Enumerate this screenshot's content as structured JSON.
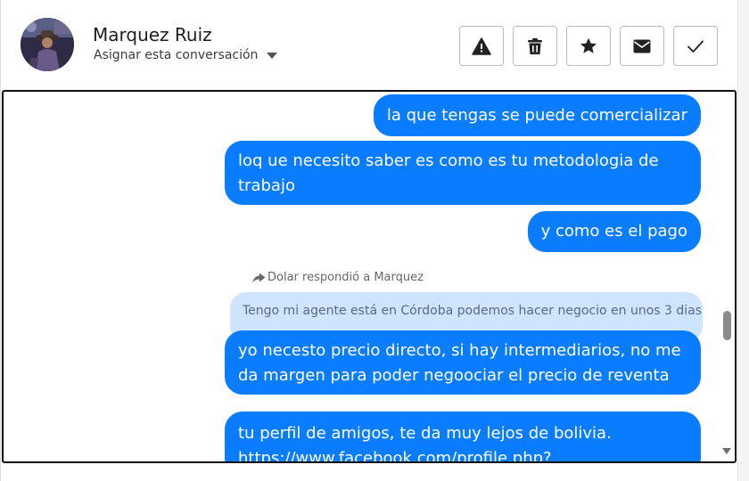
{
  "contact": {
    "name": "Marquez Ruiz",
    "assign_label": "Asignar esta conversación"
  },
  "actions": [
    {
      "icon": "warning-icon",
      "label": "report"
    },
    {
      "icon": "trash-icon",
      "label": "delete"
    },
    {
      "icon": "star-icon",
      "label": "star"
    },
    {
      "icon": "envelope-icon",
      "label": "mark-unread"
    },
    {
      "icon": "check-icon",
      "label": "done"
    }
  ],
  "messages": {
    "m1": "la que tengas se puede comercializar",
    "m2": "loq ue necesito saber es como es tu metodologia de trabajo",
    "m3": "y como es el pago",
    "reply_note": "Dolar respondió a Marquez",
    "quoted": "Tengo mi agente está en Córdoba podemos hacer negocio en unos 3 dias",
    "m4": "yo necesto precio directo, si hay intermediarios, no me da margen para poder negoociar el precio de reventa",
    "m5": "tu perfil de amigos, te da muy lejos de bolivia. https://www.facebook.com/profile.php?"
  },
  "colors": {
    "bubble": "#0a7cff",
    "quoted_bubble": "#cfe4fe"
  }
}
